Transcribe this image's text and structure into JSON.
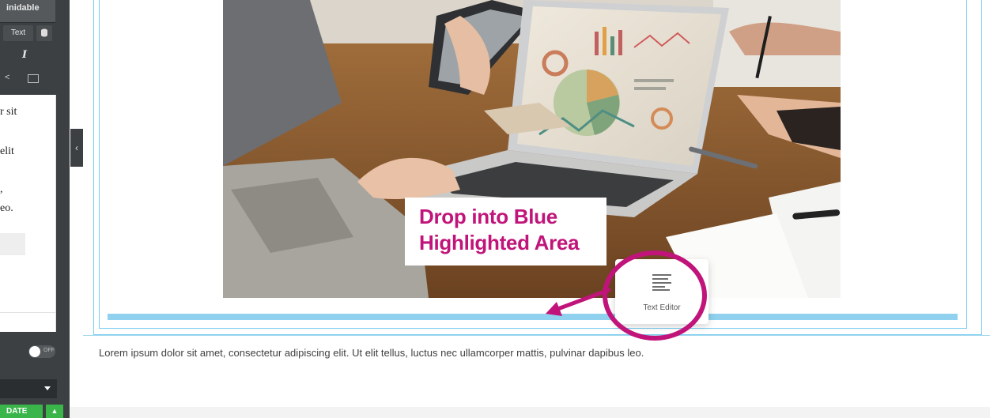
{
  "left_panel": {
    "top_label": "inidable",
    "text_button": "Text",
    "italic_button": "I",
    "editor_lines": [
      "r sit",
      "elit",
      ",",
      "eo."
    ],
    "toggle_label": "OFF",
    "update_button": "DATE",
    "update_caret": "▲",
    "collapse_arrow": "‹"
  },
  "callout": {
    "line1": "Drop into Blue",
    "line2": "Highlighted Area"
  },
  "dragged_widget": {
    "label": "Text Editor",
    "icon": "text-editor-icon"
  },
  "content": {
    "paragraph": "Lorem ipsum dolor sit amet, consectetur adipiscing elit. Ut elit tellus, luctus nec ullamcorper mattis, pulvinar dapibus leo."
  },
  "colors": {
    "accent_magenta": "#c1147a",
    "highlight_blue": "#8fd1ee",
    "update_green": "#39b54a",
    "panel_dark": "#3d4043"
  }
}
